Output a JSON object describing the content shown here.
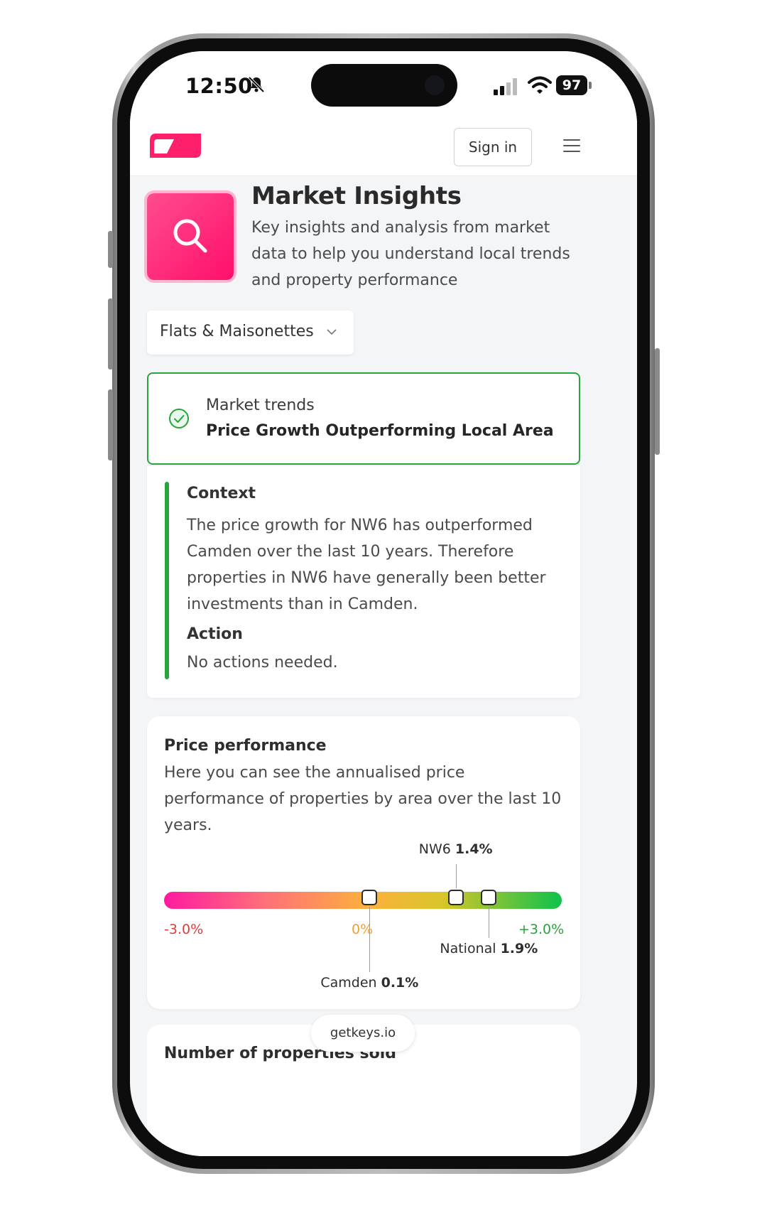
{
  "status_bar": {
    "time": "12:50",
    "battery": "97"
  },
  "header": {
    "signin_label": "Sign in"
  },
  "hero": {
    "title": "Market Insights",
    "subtitle": "Key insights and analysis from market data to help you understand local trends and property performance"
  },
  "filter": {
    "selected": "Flats & Maisonettes"
  },
  "trend": {
    "label": "Market trends",
    "value": "Price Growth Outperforming Local Area"
  },
  "context": {
    "heading": "Context",
    "text": "The price growth for NW6 has outperformed Camden over the last 10 years. Therefore properties in NW6 have generally been better investments than in Camden.",
    "action_heading": "Action",
    "action_text": "No actions needed."
  },
  "price_performance": {
    "title": "Price performance",
    "description": "Here you can see the annualised price performance of properties by area over the last 10 years.",
    "scale": {
      "min_label": "-3.0%",
      "mid_label": "0%",
      "max_label": "+3.0%",
      "min": -3.0,
      "max": 3.0
    },
    "markers": [
      {
        "area": "NW6",
        "value_label": "1.4%",
        "value": 1.4
      },
      {
        "area": "National",
        "value_label": "1.9%",
        "value": 1.9
      },
      {
        "area": "Camden",
        "value_label": "0.1%",
        "value": 0.1
      }
    ]
  },
  "next_section": {
    "title": "Number of properties sold"
  },
  "browser": {
    "url": "getkeys.io"
  },
  "colors": {
    "brand": "#ff1f6b",
    "positive": "#29a33c",
    "negative": "#e03a3a",
    "neutral": "#f0a030"
  }
}
